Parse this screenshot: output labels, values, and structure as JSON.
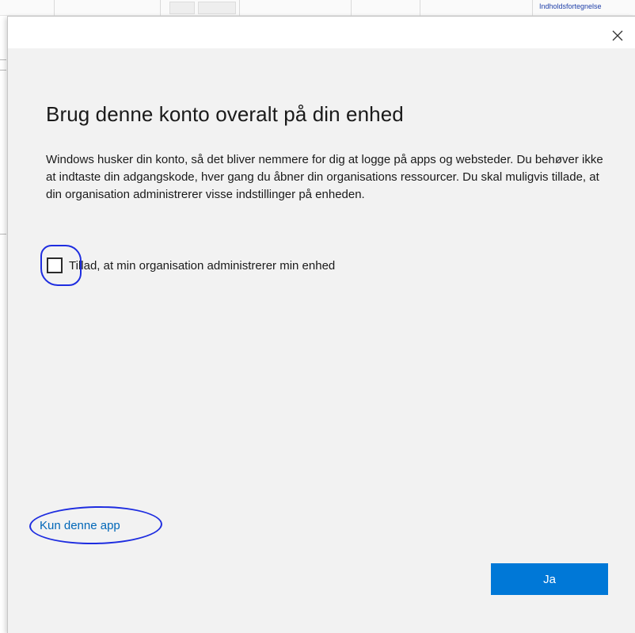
{
  "background_app": {
    "link_text": "Indholdsfortegnelse"
  },
  "dialog": {
    "close_icon": "close-icon",
    "title": "Brug denne konto overalt på din enhed",
    "body": "Windows husker din konto, så det bliver nemmere for dig at logge på apps og websteder. Du behøver ikke at indtaste din adgangskode, hver gang du åbner din organisations ressourcer. Du skal muligvis tillade, at din organisation administrerer visse indstillinger på enheden.",
    "checkbox": {
      "label": "Tillad, at min organisation administrerer min enhed",
      "checked": false
    },
    "link_label": "Kun denne app",
    "primary_button_label": "Ja"
  },
  "colors": {
    "dialog_background": "#f2f2f2",
    "accent": "#0078d7",
    "link": "#0067b8",
    "annotation_ink": "#1e2de0"
  }
}
